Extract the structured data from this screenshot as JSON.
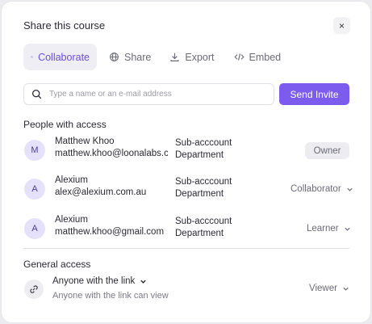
{
  "modal": {
    "title": "Share this course",
    "close_label": "×"
  },
  "tabs": [
    {
      "label": "Collaborate",
      "icon": "users-icon",
      "active": true
    },
    {
      "label": "Share",
      "icon": "globe-icon",
      "active": false
    },
    {
      "label": "Export",
      "icon": "download-icon",
      "active": false
    },
    {
      "label": "Embed",
      "icon": "code-icon",
      "active": false
    }
  ],
  "search": {
    "placeholder": "Type a name or an e-mail address",
    "value": ""
  },
  "invite_button": "Send Invite",
  "people_section_label": "People with access",
  "people": [
    {
      "initial": "M",
      "name": "Matthew Khoo",
      "email": "matthew.khoo@loonalabs.com",
      "dept_line1": "Sub-acccount",
      "dept_line2": "Department",
      "role": "Owner"
    },
    {
      "initial": "A",
      "name": "Alexium",
      "email": "alex@alexium.com.au",
      "dept_line1": "Sub-acccount",
      "dept_line2": "Department",
      "role": "Collaborator"
    },
    {
      "initial": "A",
      "name": "Alexium",
      "email": "matthew.khoo@gmail.com",
      "dept_line1": "Sub-acccount",
      "dept_line2": "Department",
      "role": "Learner"
    }
  ],
  "general_section_label": "General access",
  "general_access": {
    "setting": "Anyone with the link",
    "description": "Anyone with the link can view",
    "role": "Viewer"
  },
  "colors": {
    "accent": "#7c5cef",
    "active_tab_text": "#6b4fd8",
    "avatar_bg": "#e5e1fb"
  }
}
